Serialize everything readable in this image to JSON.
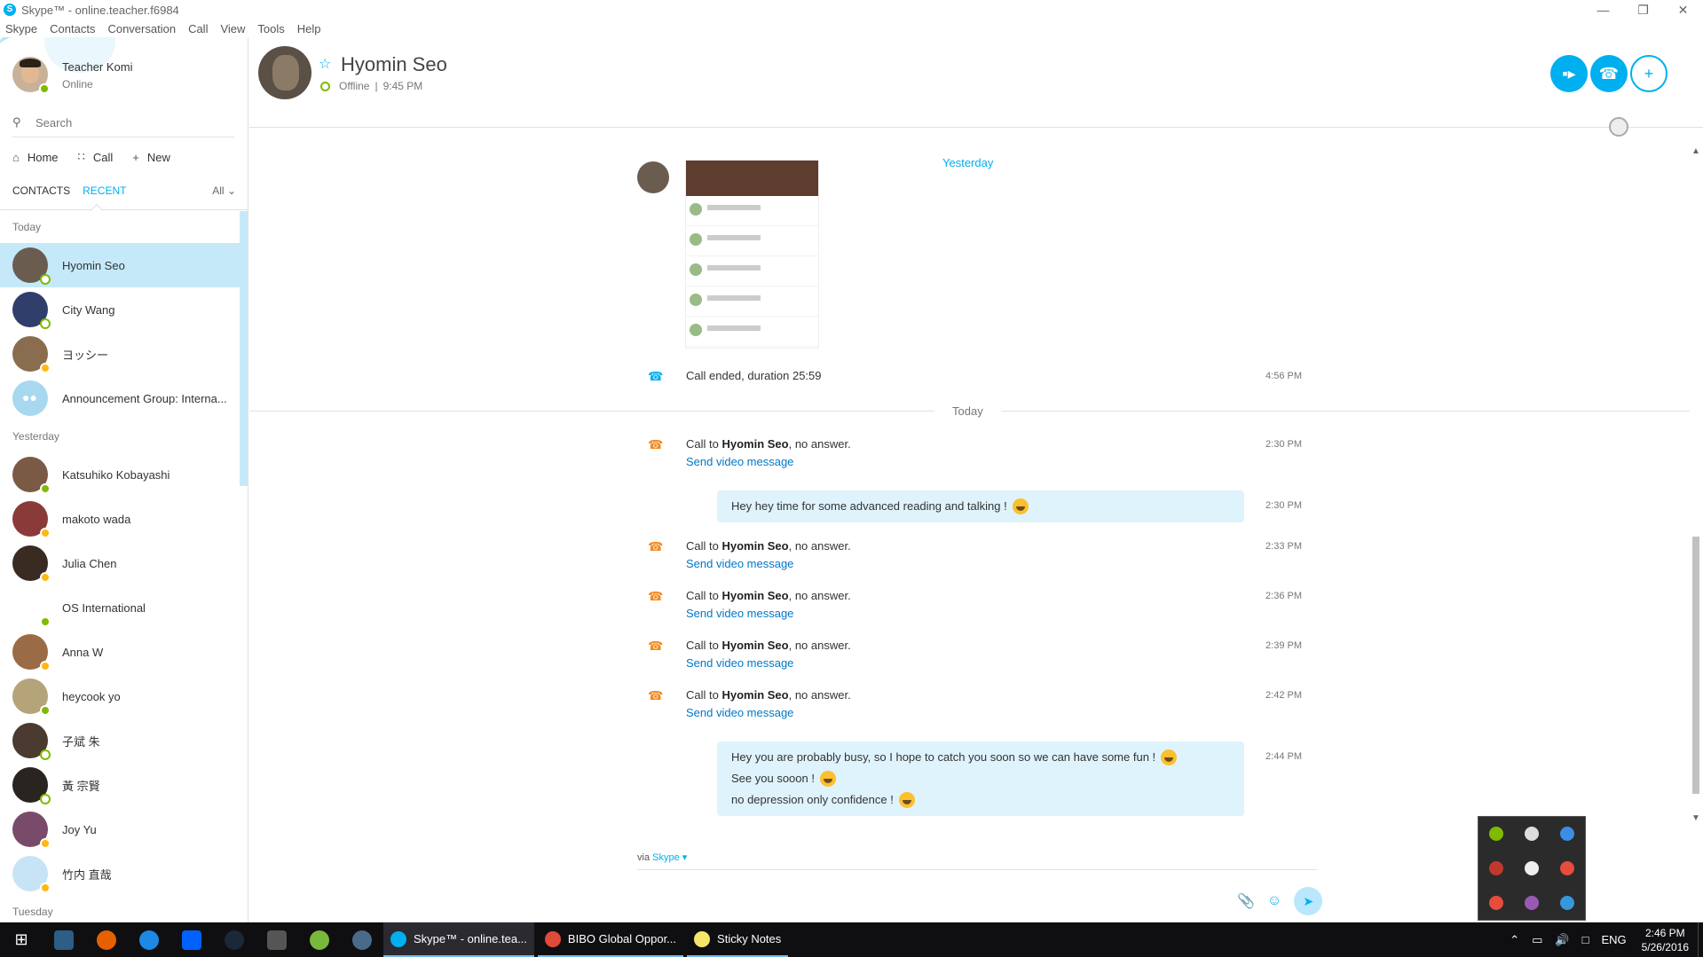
{
  "window": {
    "title": "Skype™ - online.teacher.f6984"
  },
  "menu": [
    "Skype",
    "Contacts",
    "Conversation",
    "Call",
    "View",
    "Tools",
    "Help"
  ],
  "profile": {
    "name": "Teacher Komi",
    "status": "Online"
  },
  "search": {
    "placeholder": "Search"
  },
  "nav": {
    "home": "Home",
    "call": "Call",
    "new": "New"
  },
  "tabs": {
    "contacts": "CONTACTS",
    "recent": "RECENT",
    "filter": "All"
  },
  "sections": {
    "today": "Today",
    "yesterday": "Yesterday",
    "tuesday": "Tuesday"
  },
  "contacts_today": [
    {
      "name": "Hyomin Seo",
      "status": "offline",
      "color": "#6a5d50"
    },
    {
      "name": "City Wang",
      "status": "offline",
      "color": "#2f3e6b"
    },
    {
      "name": "ヨッシー",
      "status": "away",
      "color": "#8a6d4e"
    },
    {
      "name": "Announcement Group: Interna...",
      "status": "group",
      "color": "#a8d8f0"
    }
  ],
  "contacts_yesterday": [
    {
      "name": "Katsuhiko Kobayashi",
      "status": "online",
      "color": "#7a5a44"
    },
    {
      "name": "makoto wada",
      "status": "away",
      "color": "#8b3a3a"
    },
    {
      "name": "Julia Chen",
      "status": "away",
      "color": "#3a2b22"
    },
    {
      "name": "OS International",
      "status": "online",
      "color": "#ffffff"
    },
    {
      "name": "Anna W",
      "status": "away",
      "color": "#9a6b44"
    },
    {
      "name": "heycook yo",
      "status": "online",
      "color": "#b5a37a"
    },
    {
      "name": "子斌 朱",
      "status": "offline",
      "color": "#4a3a30"
    },
    {
      "name": "黃 宗賢",
      "status": "offline",
      "color": "#2a2420"
    },
    {
      "name": "Joy Yu",
      "status": "away",
      "color": "#7a4a6a"
    },
    {
      "name": "竹内 直哉",
      "status": "away",
      "color": "#c6e4f5"
    }
  ],
  "conversation": {
    "name": "Hyomin Seo",
    "status": "Offline",
    "local_time": "9:45 PM",
    "yesterday_label": "Yesterday",
    "today_label": "Today",
    "call_ended": "Call ended, duration 25:59",
    "call_ended_time": "4:56 PM",
    "call_prefix": "Call to ",
    "call_suffix": ", no answer.",
    "send_video": "Send video message",
    "events": [
      {
        "time": "2:30 PM"
      },
      {
        "time": "2:33 PM"
      },
      {
        "time": "2:36 PM"
      },
      {
        "time": "2:39 PM"
      },
      {
        "time": "2:42 PM"
      }
    ],
    "msg1": {
      "text": "Hey hey time for some advanced reading and talking !",
      "time": "2:30 PM"
    },
    "msg2": {
      "lines": [
        "Hey you are probably busy, so I hope to catch you soon so we can have some fun !",
        "See you sooon !",
        "no depression only confidence !"
      ],
      "time": "2:44 PM"
    },
    "via": "via",
    "via_app": "Skype"
  },
  "taskbar": {
    "apps": [
      {
        "label": "Skype™ - online.tea...",
        "color": "#00aff0"
      },
      {
        "label": "BIBO Global Oppor...",
        "color": "#e04a3a"
      },
      {
        "label": "Sticky Notes",
        "color": "#f5e66b"
      }
    ],
    "lang": "ENG",
    "time": "2:46 PM",
    "date": "5/26/2016"
  },
  "colors": {
    "accent": "#00aff0",
    "selected": "#c6e9fa",
    "bubble": "#dff3fc",
    "call_icon": "#f28a1e",
    "link": "#0078c8"
  }
}
